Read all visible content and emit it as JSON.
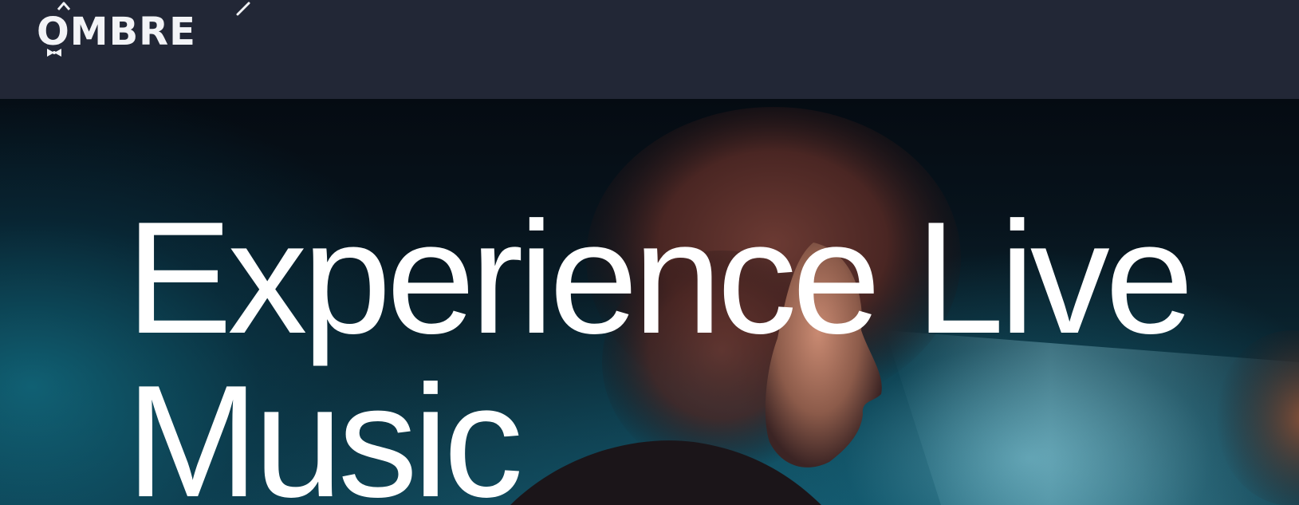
{
  "header": {
    "logo_text": "OMBRE"
  },
  "hero": {
    "title_line_1": "Experience Live",
    "title_line_2": "Music"
  },
  "colors": {
    "navbar_bg": "#222736",
    "hero_text": "#ffffff",
    "accent_teal": "#178fa6"
  },
  "icons": [
    "logo-sparkle-icon",
    "logo-bow-icon"
  ]
}
